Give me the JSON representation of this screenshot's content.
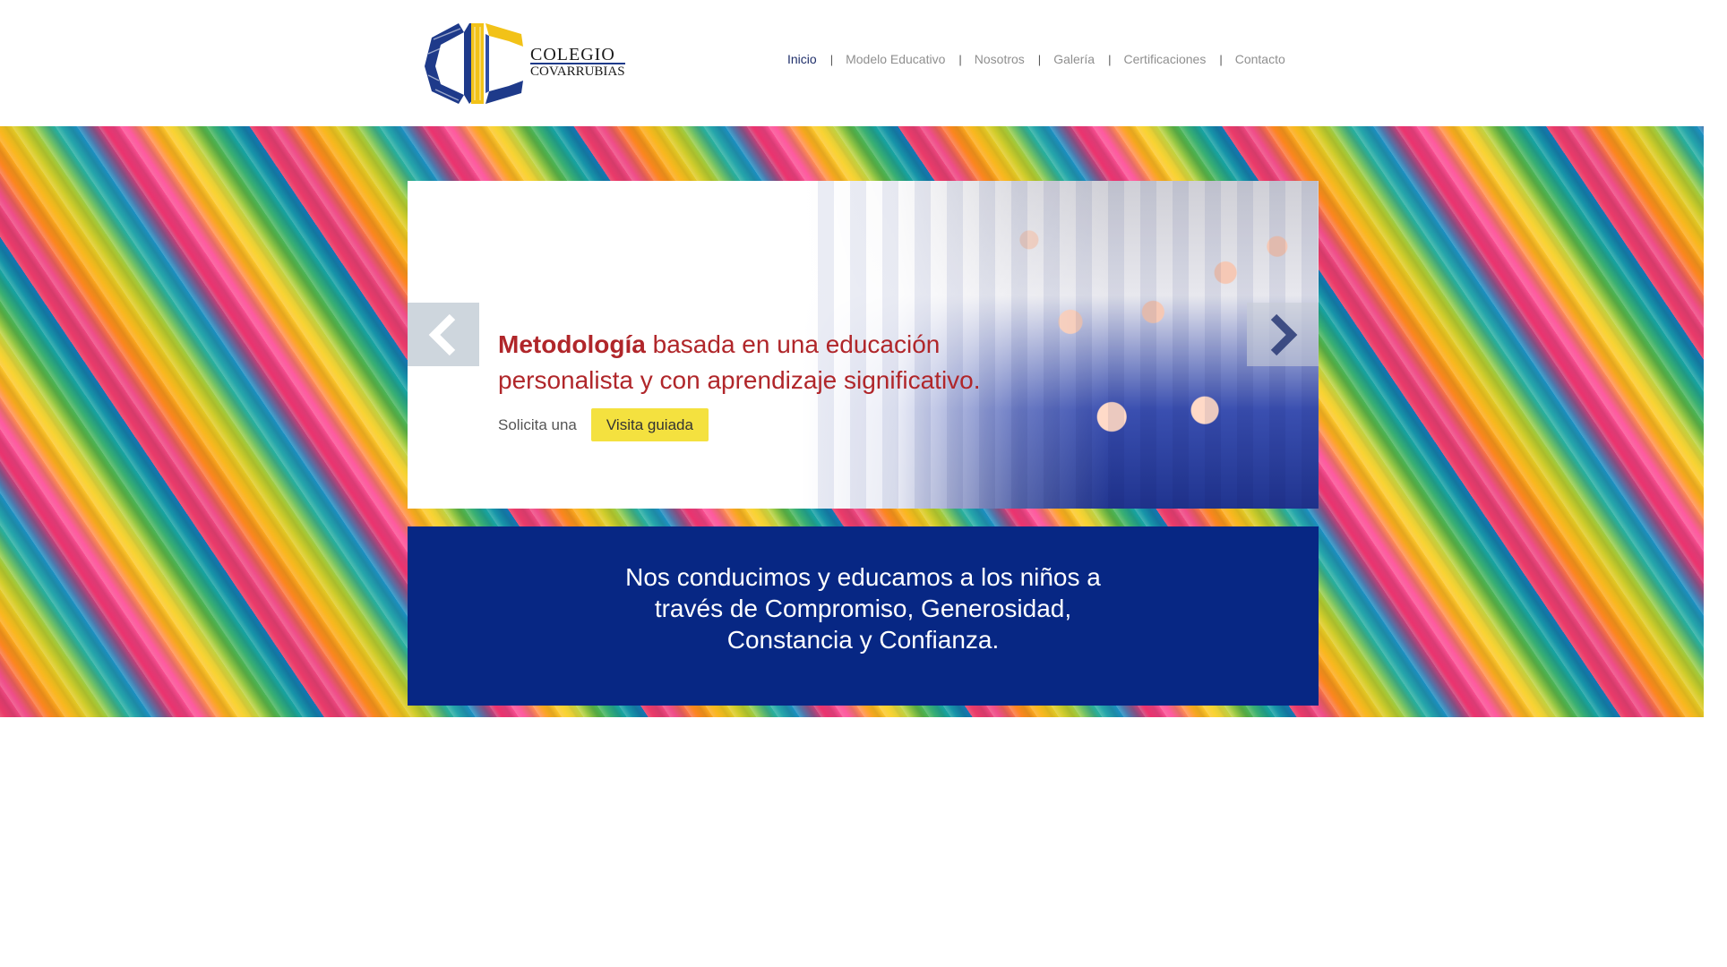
{
  "brand": {
    "line1": "COLEGIO",
    "line2": "COVARRUBIAS",
    "colors": {
      "navy": "#1e3a8a",
      "gold": "#f2c218"
    }
  },
  "nav": {
    "items": [
      {
        "label": "Inicio",
        "active": true
      },
      {
        "label": "Modelo Educativo",
        "active": false
      },
      {
        "label": "Nosotros",
        "active": false
      },
      {
        "label": "Galería",
        "active": false
      },
      {
        "label": "Certificaciones",
        "active": false
      },
      {
        "label": "Contacto",
        "active": false
      }
    ],
    "separator": "|"
  },
  "slider": {
    "headline_bold": "Metodología",
    "headline_rest": " basada en una educación personalista y con aprendizaje significativo.",
    "cta_lead": "Solicita una",
    "cta_button": "Visita guiada",
    "prev_icon": "chevron-left-icon",
    "next_icon": "chevron-right-icon",
    "colors": {
      "headline": "#b0262a",
      "button": "#f4e13f"
    }
  },
  "mission": {
    "text": "Nos conducimos y educamos a los niños a través de Compromiso, Generosidad, Constancia y Confianza.",
    "background": "#072784"
  }
}
